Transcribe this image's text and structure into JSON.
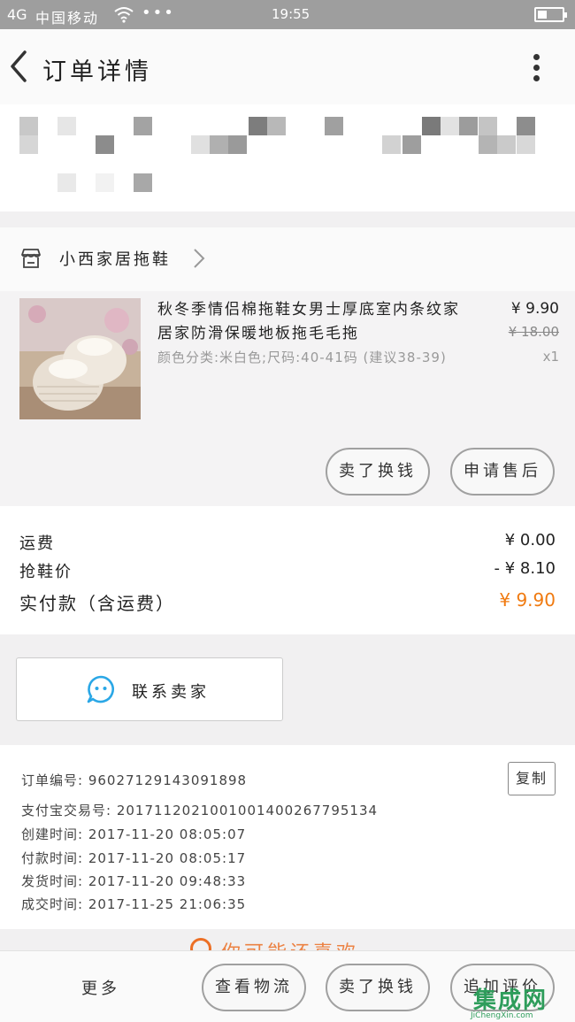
{
  "status_bar": {
    "signal": "4G",
    "carrier": "中国移动",
    "dots": "•••",
    "time": "19:55"
  },
  "header": {
    "title": "订单详情"
  },
  "shop": {
    "name": "小西家居拖鞋"
  },
  "item": {
    "name": "秋冬季情侣棉拖鞋女男士厚底室内条纹家居家防滑保暖地板拖毛毛拖",
    "spec": "颜色分类:米白色;尺码:40-41码 (建议38-39)",
    "price": "¥ 9.90",
    "original_price": "¥ 18.00",
    "quantity": "x1",
    "buttons": [
      "卖了换钱",
      "申请售后"
    ]
  },
  "totals": {
    "shipping_label": "运费",
    "shipping_value": "¥ 0.00",
    "discount_label": "抢鞋价",
    "discount_value": "- ¥ 8.10",
    "paid_label": "实付款（含运费）",
    "paid_value": "¥ 9.90"
  },
  "contact": {
    "label": "联系卖家"
  },
  "order_info": {
    "order_no_label": "订单编号:",
    "order_no": "96027129143091898",
    "copy_label": "复制",
    "alipay_label": "支付宝交易号:",
    "alipay_no": "2017112021001001400267795134",
    "created_label": "创建时间:",
    "created": "2017-11-20 08:05:07",
    "paid_label": "付款时间:",
    "paid": "2017-11-20 08:05:17",
    "shipped_label": "发货时间:",
    "shipped": "2017-11-20 09:48:33",
    "completed_label": "成交时间:",
    "completed": "2017-11-25 21:06:35"
  },
  "recommend_peek": "你可能还喜欢",
  "bottom_bar": {
    "more": "更多",
    "buttons": [
      "查看物流",
      "卖了换钱",
      "追加评价"
    ]
  },
  "watermark": {
    "logo": "集成网",
    "url": "JiChengXin.com"
  },
  "colors": {
    "accent_orange": "#f07a10",
    "status_bar": "#9e9e9e",
    "contact_icon": "#2aa7e6"
  }
}
